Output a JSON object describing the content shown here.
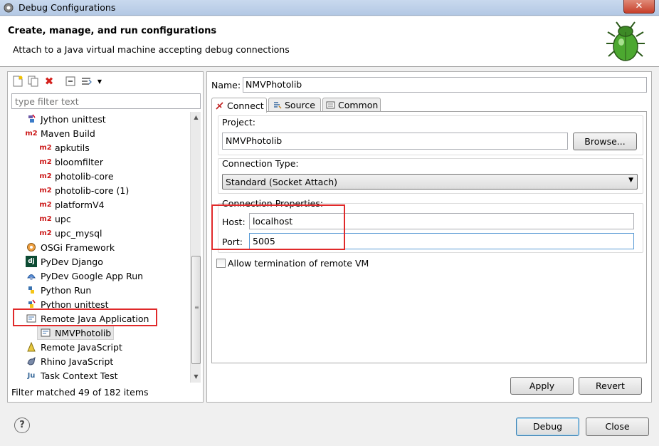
{
  "window": {
    "title": "Debug Configurations",
    "close_label": "✕"
  },
  "header": {
    "title": "Create, manage, and run configurations",
    "subtitle": "Attach to a Java virtual machine accepting debug connections"
  },
  "left": {
    "filter_placeholder": "type filter text",
    "tree": [
      {
        "label": "Jython unittest",
        "icon": "jython-unittest-icon",
        "indent": 1
      },
      {
        "label": "Maven Build",
        "icon": "maven-icon",
        "indent": 1
      },
      {
        "label": "apkutils",
        "icon": "maven-icon",
        "indent": 2
      },
      {
        "label": "bloomfilter",
        "icon": "maven-icon",
        "indent": 2
      },
      {
        "label": "photolib-core",
        "icon": "maven-icon",
        "indent": 2
      },
      {
        "label": "photolib-core (1)",
        "icon": "maven-icon",
        "indent": 2
      },
      {
        "label": "platformV4",
        "icon": "maven-icon",
        "indent": 2
      },
      {
        "label": "upc",
        "icon": "maven-icon",
        "indent": 2
      },
      {
        "label": "upc_mysql",
        "icon": "maven-icon",
        "indent": 2
      },
      {
        "label": "OSGi Framework",
        "icon": "osgi-icon",
        "indent": 1
      },
      {
        "label": "PyDev Django",
        "icon": "django-icon",
        "indent": 1
      },
      {
        "label": "PyDev Google App Run",
        "icon": "google-app-icon",
        "indent": 1
      },
      {
        "label": "Python Run",
        "icon": "python-icon",
        "indent": 1
      },
      {
        "label": "Python unittest",
        "icon": "python-unittest-icon",
        "indent": 1
      },
      {
        "label": "Remote Java Application",
        "icon": "remote-java-icon",
        "indent": 1
      },
      {
        "label": "NMVPhotolib",
        "icon": "remote-java-icon",
        "indent": 2
      },
      {
        "label": "Remote JavaScript",
        "icon": "remote-javascript-icon",
        "indent": 1
      },
      {
        "label": "Rhino JavaScript",
        "icon": "rhino-icon",
        "indent": 1
      },
      {
        "label": "Task Context Test",
        "icon": "ju-icon",
        "indent": 1
      }
    ],
    "m2_badge": "m2",
    "filter_status": "Filter matched 49 of 182 items"
  },
  "right": {
    "name_label": "Name:",
    "name_value": "NMVPhotolib",
    "tabs": [
      {
        "label": "Connect"
      },
      {
        "label": "Source"
      },
      {
        "label": "Common"
      }
    ],
    "project_label": "Project:",
    "project_value": "NMVPhotolib",
    "browse_label": "Browse...",
    "connection_type_label": "Connection Type:",
    "connection_type_value": "Standard (Socket Attach)",
    "connection_props_label": "Connection Properties:",
    "host_label": "Host:",
    "host_value": "localhost",
    "port_label": "Port:",
    "port_value": "5005",
    "allow_termination_label": "Allow termination of remote VM",
    "apply_label": "Apply",
    "revert_label": "Revert"
  },
  "footer": {
    "help_label": "?",
    "debug_label": "Debug",
    "close_label": "Close"
  },
  "colors": {
    "highlight_box": "#e0292a",
    "maven": "#cc1a1a"
  }
}
